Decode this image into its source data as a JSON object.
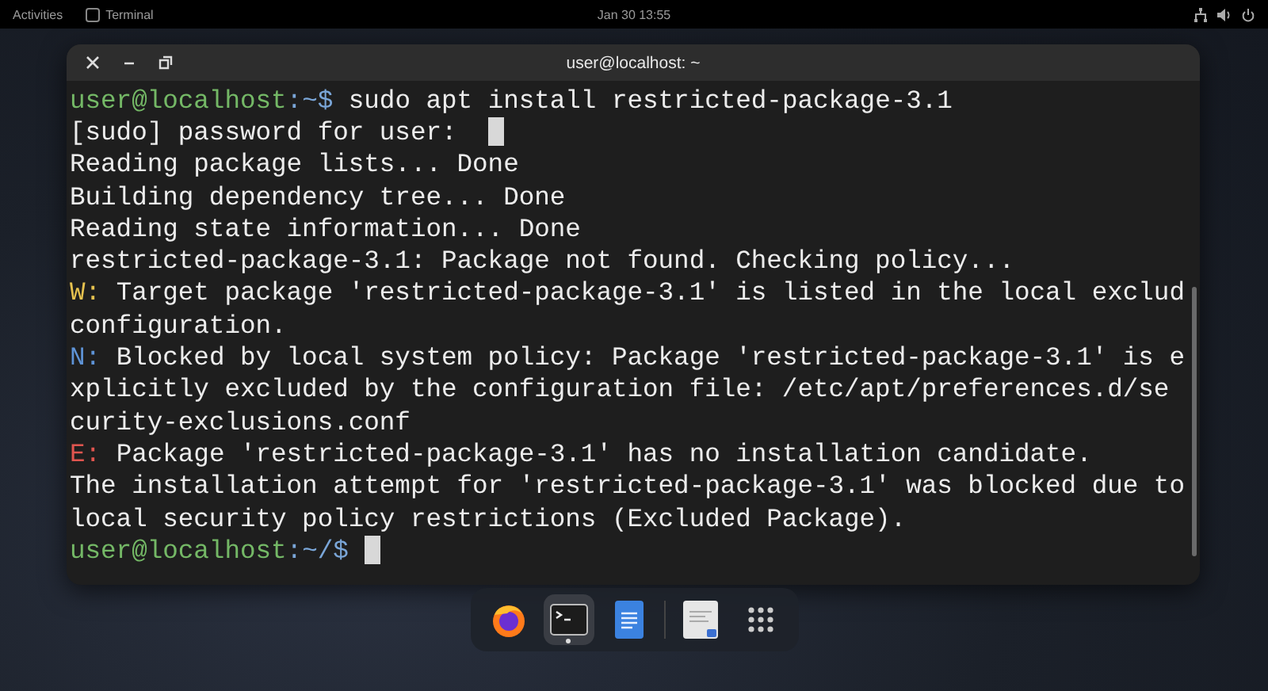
{
  "top_bar": {
    "activities": "Activities",
    "app_name": "Terminal",
    "clock": "Jan 30 13:55"
  },
  "window": {
    "title": "user@localhost: ~"
  },
  "terminal": {
    "lines": [
      {
        "cursor": false,
        "segments": [
          {
            "kind": "user",
            "text": "user@localhost"
          },
          {
            "kind": "path",
            "text": ":~$"
          },
          {
            "kind": "plain",
            "text": " sudo apt install restricted-package-3.1"
          }
        ]
      },
      {
        "cursor": true,
        "segments": [
          {
            "kind": "plain",
            "text": "[sudo] password for user: "
          }
        ]
      },
      {
        "cursor": false,
        "segments": [
          {
            "kind": "plain",
            "text": "Reading package lists... Done"
          }
        ]
      },
      {
        "cursor": false,
        "segments": [
          {
            "kind": "plain",
            "text": "Building dependency tree... Done"
          }
        ]
      },
      {
        "cursor": false,
        "segments": [
          {
            "kind": "plain",
            "text": "Reading state information... Done"
          }
        ]
      },
      {
        "cursor": false,
        "segments": [
          {
            "kind": "plain",
            "text": "restricted-package-3.1: Package not found. Checking policy..."
          }
        ]
      },
      {
        "cursor": false,
        "segments": [
          {
            "kind": "warning",
            "text": "W:"
          },
          {
            "kind": "plain",
            "text": " Target package 'restricted-package-3.1' is listed in the local exclud"
          }
        ]
      },
      {
        "cursor": false,
        "segments": [
          {
            "kind": "plain",
            "text": "configuration."
          }
        ]
      },
      {
        "cursor": false,
        "segments": [
          {
            "kind": "notice",
            "text": "N:"
          },
          {
            "kind": "plain",
            "text": " Blocked by local system policy: Package 'restricted-package-3.1' is e"
          }
        ]
      },
      {
        "cursor": false,
        "segments": [
          {
            "kind": "plain",
            "text": "xplicitly excluded by the configuration file: /etc/apt/preferences.d/se"
          }
        ]
      },
      {
        "cursor": false,
        "segments": [
          {
            "kind": "plain",
            "text": "curity-exclusions.conf"
          }
        ]
      },
      {
        "cursor": false,
        "segments": [
          {
            "kind": "error",
            "text": "E:"
          },
          {
            "kind": "plain",
            "text": " Package 'restricted-package-3.1' has no installation candidate."
          }
        ]
      },
      {
        "cursor": false,
        "segments": [
          {
            "kind": "plain",
            "text": "The installation attempt for 'restricted-package-3.1' was blocked due to"
          }
        ]
      },
      {
        "cursor": false,
        "segments": [
          {
            "kind": "plain",
            "text": "local security policy restrictions (Excluded Package)."
          }
        ]
      },
      {
        "cursor": true,
        "segments": [
          {
            "kind": "user",
            "text": "user@localhost"
          },
          {
            "kind": "path",
            "text": ":~/$"
          }
        ]
      }
    ]
  },
  "dock": {
    "favorites": [
      {
        "kind": "browser",
        "selected": false
      },
      {
        "kind": "terminal",
        "selected": true
      },
      {
        "kind": "document",
        "selected": false
      }
    ],
    "extra": [
      {
        "kind": "notes",
        "selected": false
      },
      {
        "kind": "app-grid",
        "selected": false
      }
    ]
  }
}
